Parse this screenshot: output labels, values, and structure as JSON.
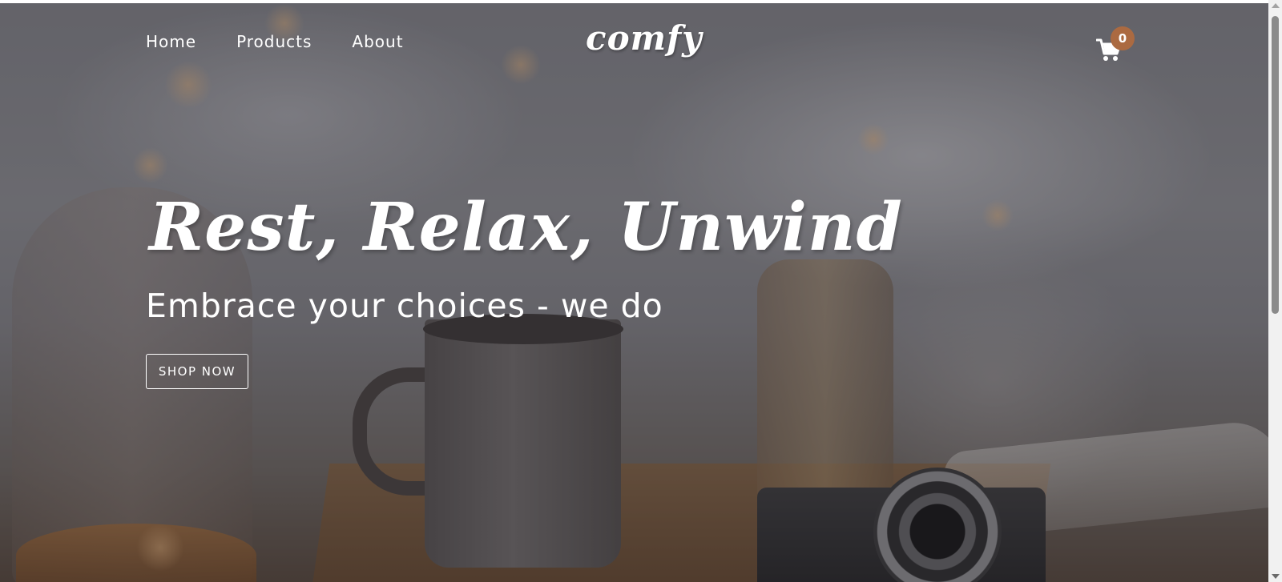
{
  "nav": {
    "links": [
      "Home",
      "Products",
      "About"
    ],
    "logo": "comfy",
    "cart": {
      "icon": "shopping-cart-icon",
      "count": "0",
      "badge_color": "#ab6a41"
    }
  },
  "hero": {
    "title": "Rest, Relax, Unwind",
    "subtitle": "Embrace your choices - we do",
    "cta_label": "SHOP NOW",
    "overlay_color": "#28262a"
  }
}
